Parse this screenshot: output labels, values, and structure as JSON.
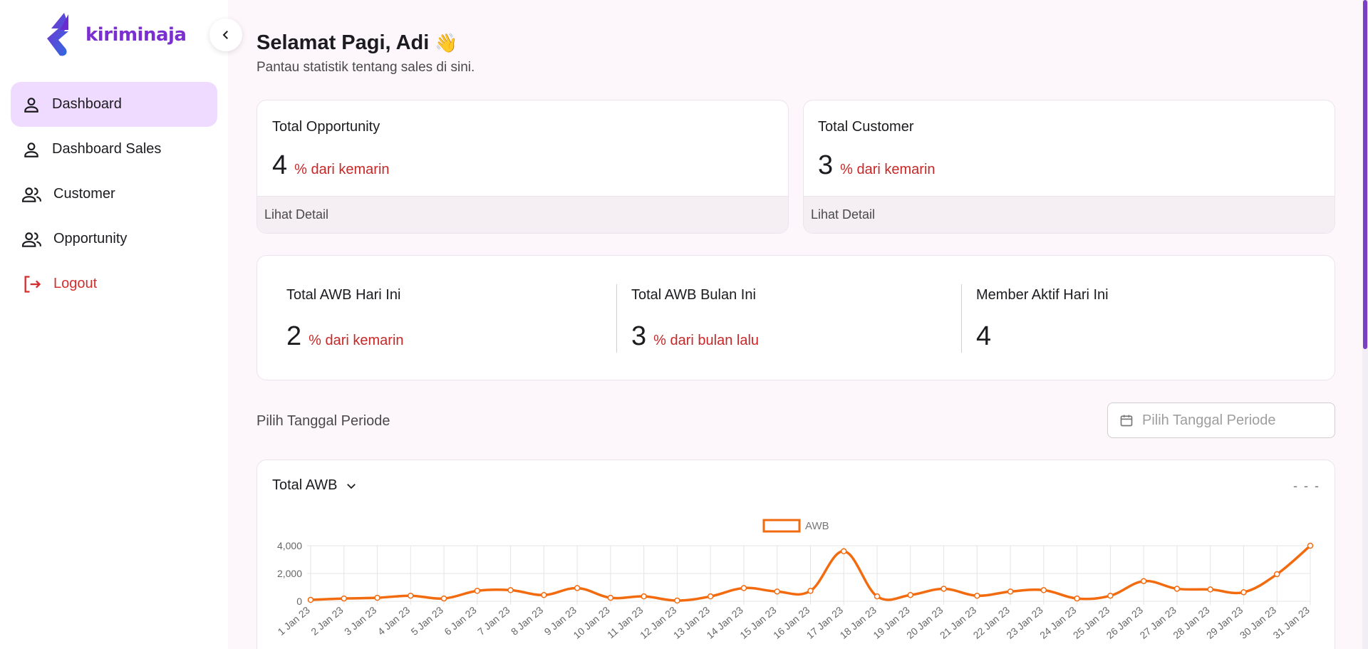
{
  "brand": {
    "name": "kiriminaja",
    "accent": "#7b2fd0"
  },
  "sidebar": {
    "items": [
      {
        "label": "Dashboard",
        "icon": "person-icon",
        "active": true
      },
      {
        "label": "Dashboard Sales",
        "icon": "person-icon",
        "active": false
      },
      {
        "label": "Customer",
        "icon": "people-icon",
        "active": false
      },
      {
        "label": "Opportunity",
        "icon": "people-icon",
        "active": false
      }
    ],
    "logout_label": "Logout"
  },
  "header": {
    "greeting": "Selamat Pagi, Adi",
    "emoji": "👋",
    "subtitle": "Pantau statistik tentang sales di sini."
  },
  "cards": {
    "opportunity": {
      "title": "Total Opportunity",
      "value": "4",
      "change": "% dari kemarin",
      "footer": "Lihat Detail"
    },
    "customer": {
      "title": "Total Customer",
      "value": "3",
      "change": "% dari kemarin",
      "footer": "Lihat Detail"
    }
  },
  "stats": {
    "awb_today": {
      "title": "Total AWB Hari Ini",
      "value": "2",
      "change": "% dari kemarin"
    },
    "awb_month": {
      "title": "Total AWB Bulan Ini",
      "value": "3",
      "change": "% dari bulan lalu"
    },
    "active_members": {
      "title": "Member Aktif Hari Ini",
      "value": "4"
    }
  },
  "period": {
    "label": "Pilih Tanggal Periode",
    "placeholder": "Pilih Tanggal Periode"
  },
  "chart_panel": {
    "selector_label": "Total AWB",
    "menu_glyph": "- - -"
  },
  "colors": {
    "series": "#f26b0f",
    "negative": "#c62828",
    "active_nav": "#efdbff"
  },
  "chart_data": {
    "type": "line",
    "categories": [
      "1 Jan 23",
      "2 Jan 23",
      "3 Jan 23",
      "4 Jan 23",
      "5 Jan 23",
      "6 Jan 23",
      "7 Jan 23",
      "8 Jan 23",
      "9 Jan 23",
      "10 Jan 23",
      "11 Jan 23",
      "12 Jan 23",
      "13 Jan 23",
      "14 Jan 23",
      "15 Jan 23",
      "16 Jan 23",
      "17 Jan 23",
      "18 Jan 23",
      "19 Jan 23",
      "20 Jan 23",
      "21 Jan 23",
      "22 Jan 23",
      "23 Jan 23",
      "24 Jan 23",
      "25 Jan 23",
      "26 Jan 23",
      "27 Jan 23",
      "28 Jan 23",
      "29 Jan 23",
      "30 Jan 23",
      "31 Jan 23"
    ],
    "series": [
      {
        "name": "AWB",
        "values": [
          100,
          200,
          250,
          400,
          200,
          750,
          800,
          450,
          950,
          250,
          350,
          50,
          350,
          950,
          700,
          750,
          3600,
          350,
          450,
          900,
          400,
          700,
          800,
          200,
          400,
          1450,
          900,
          850,
          650,
          1950,
          4000
        ]
      }
    ],
    "ylim": [
      0,
      4000
    ],
    "yticks": [
      "0",
      "2,000",
      "4,000"
    ],
    "legend_position": "top-center",
    "grid": true
  }
}
